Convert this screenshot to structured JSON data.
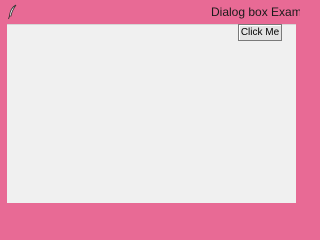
{
  "window": {
    "title": "Dialog box Examp"
  },
  "content": {
    "button_label": "Click Me"
  },
  "colors": {
    "frame": "#e86a95",
    "client": "#f0f0f0",
    "button": "#e3e3e3"
  },
  "icons": {
    "app": "feather-icon"
  }
}
